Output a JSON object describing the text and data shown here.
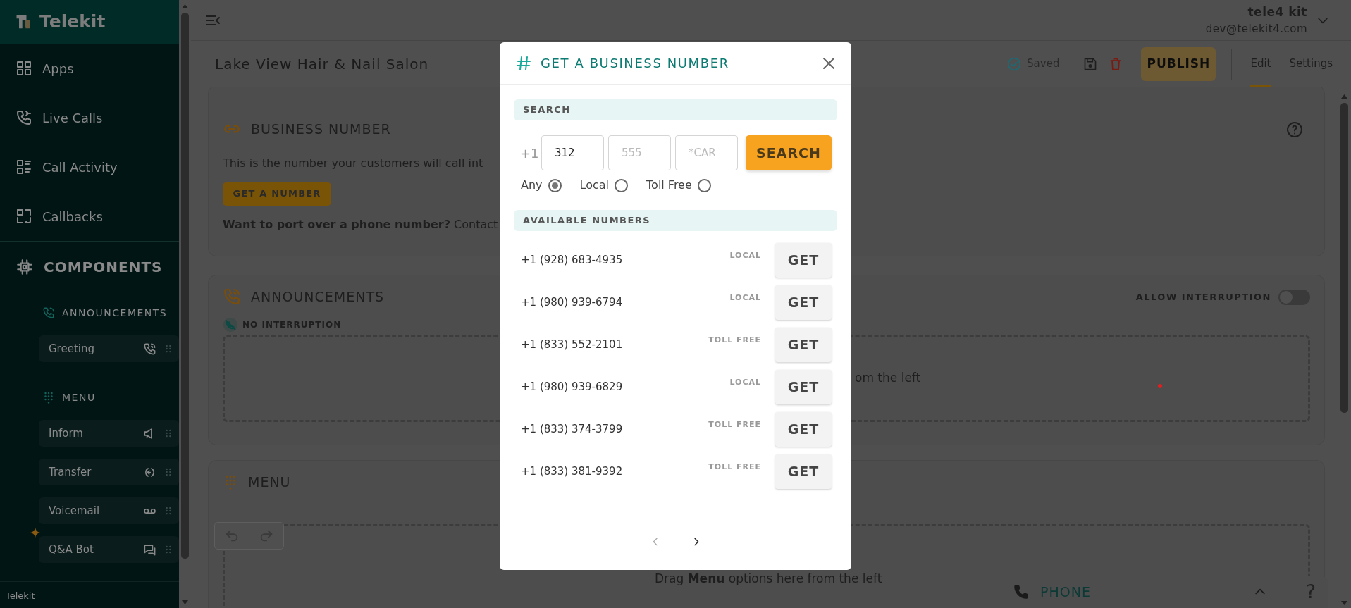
{
  "sidebar": {
    "brand": "Telekit",
    "nav": [
      {
        "label": "Apps"
      },
      {
        "label": "Live Calls"
      },
      {
        "label": "Call Activity"
      },
      {
        "label": "Callbacks"
      }
    ],
    "components": {
      "heading": "COMPONENTS",
      "groups": [
        {
          "title": "ANNOUNCEMENTS",
          "items": [
            {
              "label": "Greeting",
              "featured": false
            }
          ]
        },
        {
          "title": "MENU",
          "items": [
            {
              "label": "Inform",
              "featured": false
            },
            {
              "label": "Transfer",
              "featured": false
            },
            {
              "label": "Voicemail",
              "featured": false
            },
            {
              "label": "Q&A Bot",
              "featured": true
            }
          ]
        }
      ]
    },
    "footer": "Telekit"
  },
  "account": {
    "name": "tele4 kit",
    "email": "dev@telekit4.com"
  },
  "toolbar": {
    "title": "Lake View Hair & Nail Salon",
    "status": "Saved",
    "publish": {
      "label": "PUBLISH",
      "disabled": true
    },
    "tabs": [
      {
        "label": "Edit",
        "selected": true
      },
      {
        "label": "Settings",
        "selected": false
      }
    ]
  },
  "business_number": {
    "title": "BUSINESS NUMBER",
    "text": "This is the number your customers will call int",
    "button": "GET A NUMBER",
    "port_text": "**Want to port over a phone number?** Contact"
  },
  "announcements": {
    "title": "ANNOUNCEMENTS",
    "toggle_label": "ALLOW INTERRUPTION",
    "toggle_on": false,
    "mode": "NO INTERRUPTION",
    "drop_text": "om the left"
  },
  "menu": {
    "title": "MENU",
    "drop_text": "Drag **Menu** options here from the left"
  },
  "phone_bar": {
    "label": "PHONE"
  },
  "help": {
    "label": "?"
  },
  "modal": {
    "title": "GET A BUSINESS NUMBER",
    "search": {
      "heading": "SEARCH",
      "prefix": "+1",
      "fields": [
        {
          "value": "312"
        },
        {
          "placeholder": "555"
        },
        {
          "placeholder": "*CAR"
        }
      ],
      "button": "SEARCH",
      "types": [
        {
          "label": "Any",
          "selected": true
        },
        {
          "label": "Local",
          "selected": false
        },
        {
          "label": "Toll Free",
          "selected": false
        }
      ]
    },
    "available": {
      "heading": "AVAILABLE NUMBERS",
      "rows": [
        {
          "number": "+1 (928) 683-4935",
          "type": "LOCAL",
          "button": "GET"
        },
        {
          "number": "+1 (980) 939-6794",
          "type": "LOCAL",
          "button": "GET"
        },
        {
          "number": "+1 (833) 552-2101",
          "type": "TOLL FREE",
          "button": "GET"
        },
        {
          "number": "+1 (980) 939-6829",
          "type": "LOCAL",
          "button": "GET"
        },
        {
          "number": "+1 (833) 374-3799",
          "type": "TOLL FREE",
          "button": "GET"
        },
        {
          "number": "+1 (833) 381-9392",
          "type": "TOLL FREE",
          "button": "GET"
        }
      ]
    },
    "pagination": {
      "prev_disabled": true,
      "next_disabled": false
    }
  }
}
